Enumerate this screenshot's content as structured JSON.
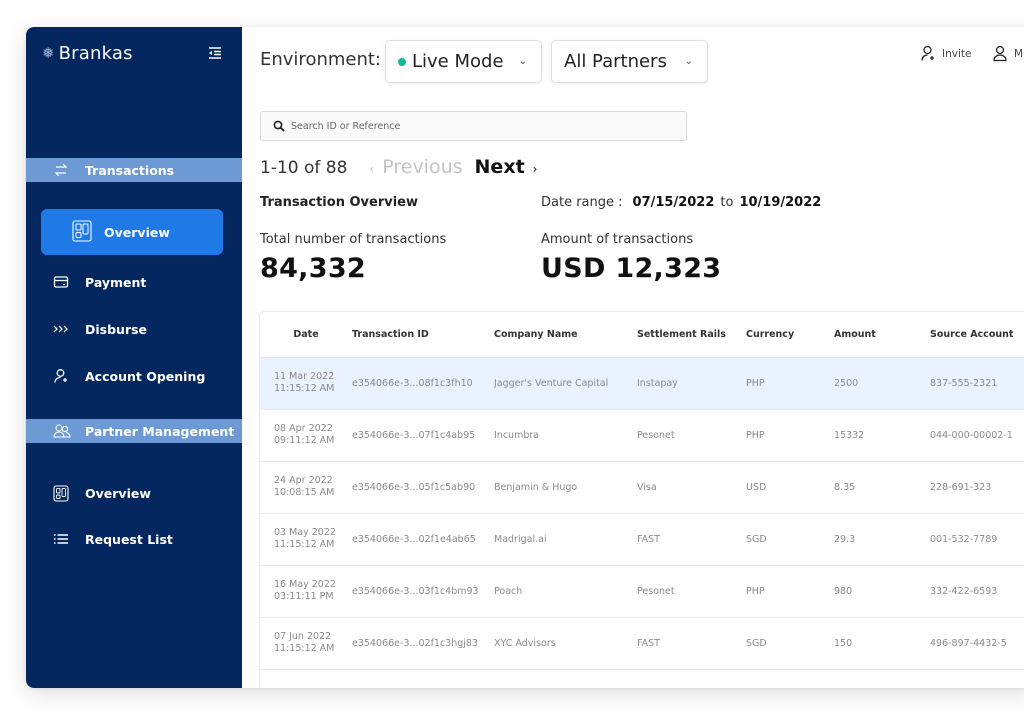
{
  "app": {
    "brand_name": "Brankas",
    "brand_icon": "snowflake-logo-icon"
  },
  "sidebar": {
    "collapse_icon": "collapse-menu-icon",
    "sections": [
      {
        "label": "Transactions",
        "icon": "arrows-swap-icon",
        "items": [
          {
            "label": "Overview",
            "icon": "dashboard-grid-icon",
            "active": true
          },
          {
            "label": "Payment",
            "icon": "card-icon",
            "active": false
          },
          {
            "label": "Disburse",
            "icon": "triple-chevron-icon",
            "active": false
          },
          {
            "label": "Account Opening",
            "icon": "user-add-icon",
            "active": false
          }
        ]
      },
      {
        "label": "Partner Management",
        "icon": "users-icon",
        "items": [
          {
            "label": "Overview",
            "icon": "dashboard-grid-icon",
            "active": false
          },
          {
            "label": "Request List",
            "icon": "list-icon",
            "active": false
          }
        ]
      }
    ]
  },
  "header": {
    "environment_label": "Environment:",
    "environment_value": "Live Mode",
    "environment_status_color": "#14b7a0",
    "partner_value": "All Partners",
    "actions": [
      {
        "label": "Invite",
        "icon": "user-add-icon"
      },
      {
        "label": "M",
        "icon": "user-icon"
      }
    ]
  },
  "search": {
    "placeholder": "Search ID or Reference",
    "value": ""
  },
  "pagination": {
    "range_text": "1-10 of 88",
    "previous_label": "Previous",
    "next_label": "Next"
  },
  "overview": {
    "title": "Transaction Overview",
    "date_range_label": "Date range :",
    "date_from": "07/15/2022",
    "date_to_label": "to",
    "date_to": "10/19/2022",
    "total_label": "Total number of transactions",
    "total_value": "84,332",
    "amount_label": "Amount of transactions",
    "amount_value": "USD 12,323"
  },
  "table": {
    "columns": [
      "Date",
      "Transaction ID",
      "Company Name",
      "Settlement Rails",
      "Currency",
      "Amount",
      "Source Account"
    ],
    "rows": [
      {
        "date": "11 Mar 2022",
        "time": "11:15:12 AM",
        "id": "e354066e-3...08f1c3fh10",
        "company": "Jagger's Venture Capital",
        "rails": "Instapay",
        "currency": "PHP",
        "amount": "2500",
        "source": "837-555-2321",
        "selected": true
      },
      {
        "date": "08 Apr 2022",
        "time": "09:11:12 AM",
        "id": "e354066e-3...07f1c4ab95",
        "company": "Incumbra",
        "rails": "Pesonet",
        "currency": "PHP",
        "amount": "15332",
        "source": "044-000-00002-1",
        "selected": false
      },
      {
        "date": "24 Apr 2022",
        "time": "10:08:15 AM",
        "id": "e354066e-3...05f1c5ab90",
        "company": "Benjamin & Hugo",
        "rails": "Visa",
        "currency": "USD",
        "amount": "8.35",
        "source": "228-691-323",
        "selected": false
      },
      {
        "date": "03 May 2022",
        "time": "11:15:12 AM",
        "id": "e354066e-3...02f1e4ab65",
        "company": "Madrigal.ai",
        "rails": "FAST",
        "currency": "SGD",
        "amount": "29.3",
        "source": "001-532-7789",
        "selected": false
      },
      {
        "date": "16 May 2022",
        "time": "03:11:11 PM",
        "id": "e354066e-3...03f1c4bm93",
        "company": "Poach",
        "rails": "Pesonet",
        "currency": "PHP",
        "amount": "980",
        "source": "332-422-6593",
        "selected": false
      },
      {
        "date": "07 Jun 2022",
        "time": "11:15:12 AM",
        "id": "e354066e-3...02f1c3hgj83",
        "company": "XYC Advisors",
        "rails": "FAST",
        "currency": "SGD",
        "amount": "150",
        "source": "496-897-4432-5",
        "selected": false
      }
    ]
  },
  "colors": {
    "sidebar_bg": "#03275e",
    "section_header_bg": "#6d9ad4",
    "active_item_bg": "#1f7ae8",
    "selected_row_bg": "#eaf2fd"
  }
}
